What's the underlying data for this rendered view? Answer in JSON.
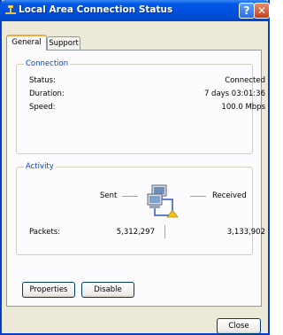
{
  "window": {
    "title": "Local Area Connection Status",
    "help_glyph": "?",
    "close_glyph": "✕"
  },
  "tabs": [
    {
      "label": "General",
      "selected": true
    },
    {
      "label": "Support",
      "selected": false
    }
  ],
  "connection": {
    "legend": "Connection",
    "rows": [
      {
        "label": "Status:",
        "value": "Connected"
      },
      {
        "label": "Duration:",
        "value": "7 days 03:01:36"
      },
      {
        "label": "Speed:",
        "value": "100.0 Mbps"
      }
    ]
  },
  "activity": {
    "legend": "Activity",
    "sent_label": "Sent",
    "received_label": "Received",
    "packets_label": "Packets:",
    "packets_sent": "5,312,297",
    "packets_received": "3,133,902",
    "icon": "network-computers-icon"
  },
  "buttons": {
    "properties": "Properties",
    "disable": "Disable",
    "close": "Close"
  },
  "colors": {
    "title_bar": "#0050dc",
    "group_legend": "#0046d5",
    "dialog_face": "#ece9d8"
  }
}
